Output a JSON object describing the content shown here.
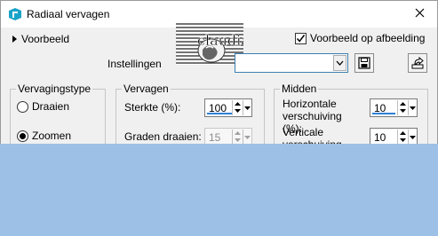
{
  "window": {
    "title": "Radiaal vervagen",
    "app_icon": "psp-icon",
    "close_icon": "close-icon"
  },
  "preview": {
    "label": "Voorbeeld",
    "icon": "triangle-right-icon"
  },
  "logo": {
    "text": "claudia"
  },
  "preview_on_image": {
    "label": "Voorbeeld op afbeelding",
    "checked": true
  },
  "settings": {
    "label": "Instellingen",
    "value": "",
    "save_icon": "save-icon",
    "reset_icon": "reset-icon"
  },
  "blur_type": {
    "title": "Vervagingstype",
    "options": [
      {
        "label": "Draaien",
        "selected": false
      },
      {
        "label": "Zoomen",
        "selected": true
      }
    ]
  },
  "blur": {
    "title": "Vervagen",
    "strength_label": "Sterkte (%):",
    "strength_value": "100",
    "twist_label": "Graden draaien:",
    "twist_value": "15"
  },
  "center": {
    "title": "Midden",
    "h_offset_label": "Horizontale verschuiving (%):",
    "h_offset_value": "10",
    "v_offset_label": "Verticale verschuiving (%):",
    "v_offset_value": "10"
  },
  "colors": {
    "background": "#9dc0e6",
    "dialog": "#f0f0f0",
    "accent": "#2f7fd4",
    "app_icon": "#1aa3c8"
  }
}
